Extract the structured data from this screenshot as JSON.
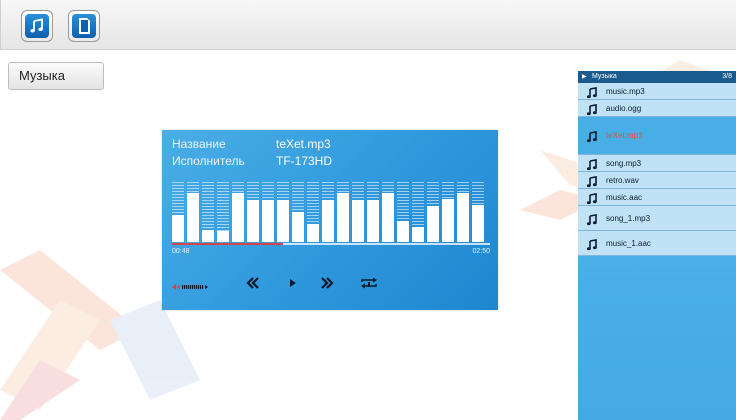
{
  "toolbar": {
    "buttons": [
      {
        "name": "music",
        "icon": "music-note-icon"
      },
      {
        "name": "sd-card",
        "icon": "sd-card-icon"
      }
    ]
  },
  "tab": {
    "label": "Музыка"
  },
  "player": {
    "title_label": "Название",
    "title_value": "teXet.mp3",
    "artist_label": "Исполнитель",
    "artist_value": "TF-173HD",
    "elapsed": "00:48",
    "total": "02:50",
    "progress": 0.35,
    "volume_icon": "volume-icon",
    "controls": [
      "prev",
      "play",
      "next",
      "repeat"
    ],
    "equalizer": [
      0.45,
      0.82,
      0.2,
      0.18,
      0.82,
      0.7,
      0.7,
      0.7,
      0.5,
      0.3,
      0.7,
      0.82,
      0.7,
      0.7,
      0.82,
      0.35,
      0.25,
      0.6,
      0.72,
      0.82,
      0.62
    ]
  },
  "playlist": {
    "header": "Музыка",
    "counter": "3/8",
    "items": [
      {
        "name": "music.mp3",
        "active": false
      },
      {
        "name": "audio.ogg",
        "active": false
      },
      {
        "name": "teXet.mp3",
        "active": true
      },
      {
        "name": "song.mp3",
        "active": false
      },
      {
        "name": "retro.wav",
        "active": false
      },
      {
        "name": "music.aac",
        "active": false
      },
      {
        "name": "song_1.mp3",
        "active": false
      },
      {
        "name": "music_1.aac",
        "active": false
      }
    ]
  },
  "colors": {
    "accent": "#2f98dc",
    "progress": "#d64545",
    "active_track": "#e64d4d"
  }
}
